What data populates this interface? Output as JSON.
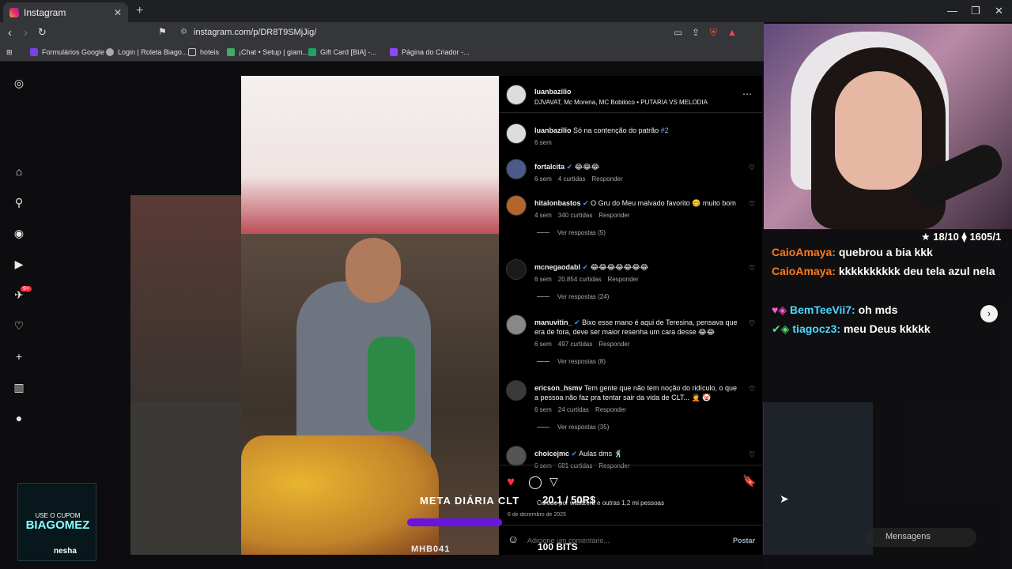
{
  "browser": {
    "tab_title": "Instagram",
    "url": "instagram.com/p/DR8T9SMjJig/",
    "bookmarks": [
      "Formulários Google",
      "Login | Roleta Biago...",
      "hoteis",
      "¡Chat • Setup | giam...",
      "Gift Card [BIA] -...",
      "Página do Criador -..."
    ]
  },
  "sidebar": {
    "notifications_badge": "9+"
  },
  "post": {
    "author": "luanbazilio",
    "audio": "DJVAVAT, Mc Morena, MC Bobiloco • PUTARIA VS MELODIA",
    "caption_user": "luanbazilio",
    "caption_text": "Só na contenção do patrão",
    "caption_tag": "#2",
    "caption_time": "6 sem",
    "overlay_text": "META DIÁRIA CLT",
    "overlay_tag": "MHB041"
  },
  "comments": [
    {
      "user": "fortalcita",
      "verified": true,
      "text": "😂😂😂",
      "time": "6 sem",
      "likes": "4 curtidas",
      "reply": "Responder",
      "replies": ""
    },
    {
      "user": "hitalonbastos",
      "verified": true,
      "text": "O Gru do Meu malvado favorito 🥴 muito bom",
      "time": "4 sem",
      "likes": "340 curtidas",
      "reply": "Responder",
      "replies": "Ver respostas (5)"
    },
    {
      "user": "mcnegaodabl",
      "verified": true,
      "text": "😂😂😂😂😂😂😂",
      "time": "6 sem",
      "likes": "20.854 curtidas",
      "reply": "Responder",
      "replies": "Ver respostas (24)"
    },
    {
      "user": "manuvitin_",
      "verified": true,
      "text": "Bixo esse mano é aqui de Teresina, pensava que era de fora, deve ser maior resenha um cara desse 😂😂",
      "time": "6 sem",
      "likes": "497 curtidas",
      "reply": "Responder",
      "replies": "Ver respostas (8)"
    },
    {
      "user": "ericson_hsmv",
      "verified": false,
      "text": "Tem gente que não tem noção do ridículo, o que a pessoa não faz pra tentar sair da vida de CLT... 🤦 🤡",
      "time": "6 sem",
      "likes": "24 curtidas",
      "reply": "Responder",
      "replies": "Ver respostas (35)"
    },
    {
      "user": "choicejmc",
      "verified": true,
      "text": "Aulas dms 🕺",
      "time": "6 sem",
      "likes": "681 curtidas",
      "reply": "Responder",
      "replies": ""
    }
  ],
  "actions": {
    "liked_by": "Curtido por wastzera e outras 1,2 mi pessoas",
    "date": "6 de dezembro de 2025",
    "comment_placeholder": "Adicione um comentário...",
    "post_button": "Postar"
  },
  "stream": {
    "stats": "★ 18/10  ⧫ 1605/1",
    "chat": [
      {
        "user": "CaioAmaya:",
        "text": "quebrou a bia kkk"
      },
      {
        "user": "CaioAmaya:",
        "text": "kkkkkkkkkk deu tela azul nela"
      },
      {
        "user": "BemTeeVii7:",
        "text": "oh mds"
      },
      {
        "user": "tiagocz3:",
        "text": "meu Deus kkkkk"
      }
    ],
    "donation": "20.1 / 50R$",
    "bits": "100 BITS",
    "coupon_small": "USE O CUPOM",
    "coupon_code": "BIAGOMEZ",
    "coupon_brand": "nesha",
    "messages_label": "Mensagens"
  },
  "colors": {
    "accent": "#3897f0",
    "like": "#ff3040",
    "chat_user1": "#ff7a1a",
    "chat_user2": "#4fd7ff"
  }
}
